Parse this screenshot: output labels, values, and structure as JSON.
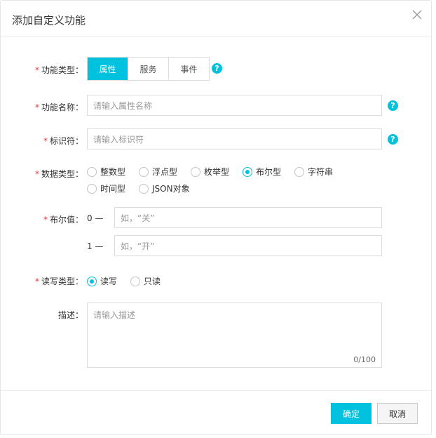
{
  "dialog": {
    "title": "添加自定义功能"
  },
  "form": {
    "function_type": {
      "label": "功能类型：",
      "options": [
        "属性",
        "服务",
        "事件"
      ],
      "selected": "属性"
    },
    "function_name": {
      "label": "功能名称：",
      "placeholder": "请输入属性名称"
    },
    "identifier": {
      "label": "标识符：",
      "placeholder": "请输入标识符"
    },
    "data_type": {
      "label": "数据类型：",
      "options": [
        "整数型",
        "浮点型",
        "枚举型",
        "布尔型",
        "字符串",
        "时间型",
        "JSON对象"
      ],
      "selected": "布尔型"
    },
    "bool_value": {
      "label": "布尔值：",
      "rows": [
        {
          "prefix": "0 —",
          "placeholder": "如，“关”"
        },
        {
          "prefix": "1 —",
          "placeholder": "如，“开”"
        }
      ]
    },
    "rw_type": {
      "label": "读写类型：",
      "options": [
        "读写",
        "只读"
      ],
      "selected": "读写"
    },
    "description": {
      "label": "描述：",
      "placeholder": "请输入描述",
      "counter": "0/100"
    },
    "required_mark": "*",
    "help_glyph": "?"
  },
  "footer": {
    "confirm_label": "确定",
    "cancel_label": "取消"
  },
  "colors": {
    "accent": "#00c1de",
    "required": "#e4393c"
  },
  "icons": {
    "close": "close-icon",
    "help": "question-circle-icon"
  }
}
